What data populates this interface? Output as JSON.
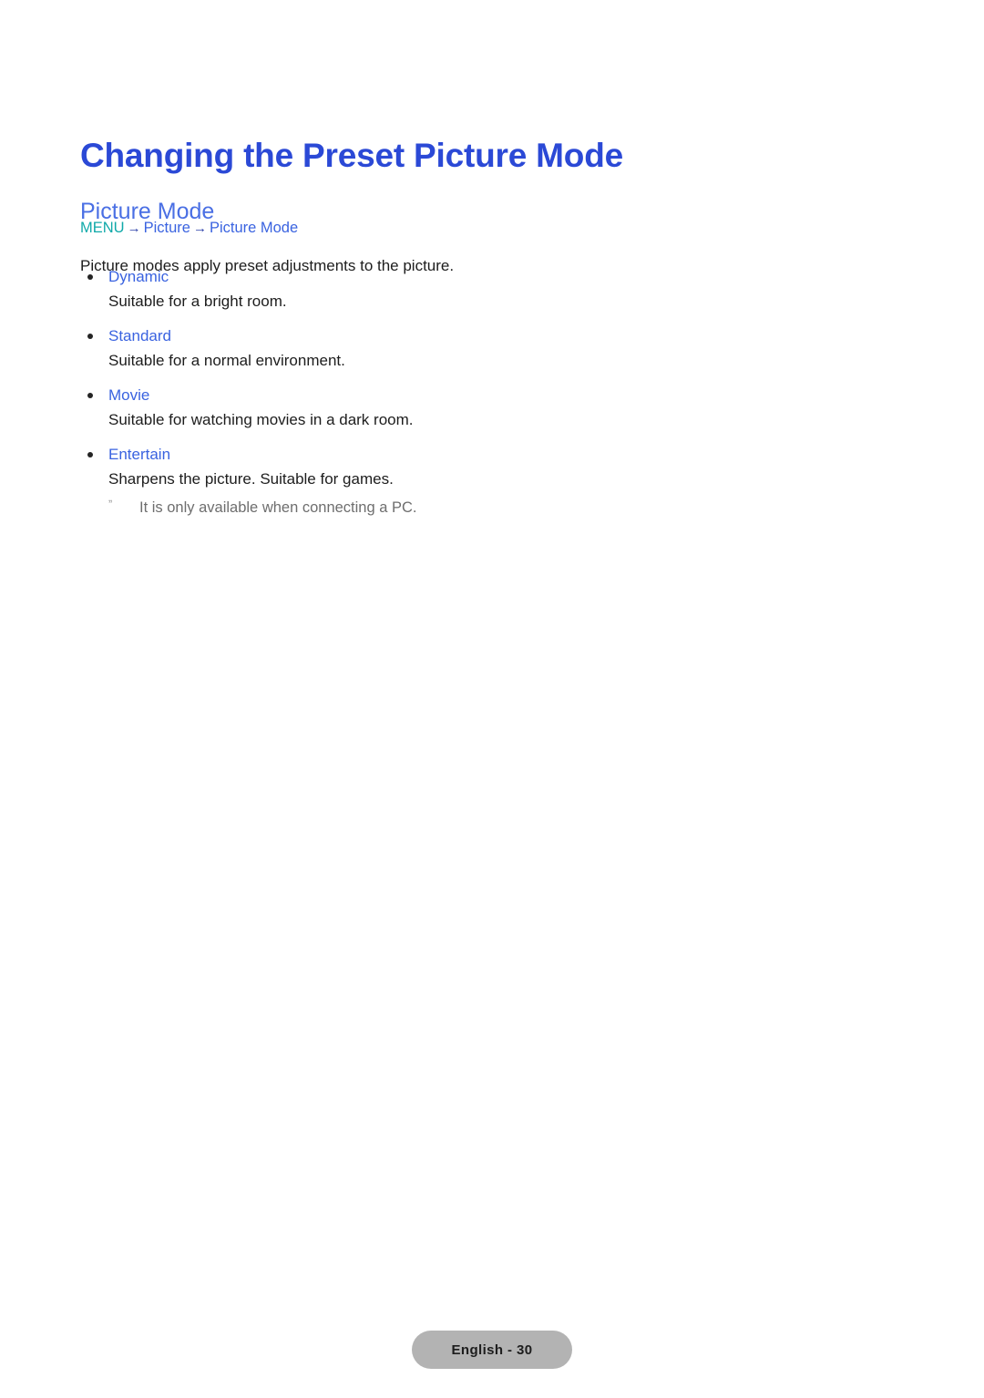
{
  "document": {
    "title": "Changing the Preset Picture Mode",
    "sub_heading": "Picture Mode",
    "intro": "Picture modes apply preset adjustments to the picture.",
    "menu_path": {
      "root": "MENU",
      "arrow": "→",
      "nodes": [
        "Picture",
        "Picture Mode"
      ]
    },
    "items": [
      {
        "label": "Dynamic",
        "description": "Suitable for a bright room."
      },
      {
        "label": "Standard",
        "description": "Suitable for a normal environment."
      },
      {
        "label": "Movie",
        "description": "Suitable for watching movies in a dark room."
      },
      {
        "label": "Entertain",
        "description": "Sharpens the picture. Suitable for games."
      }
    ],
    "note": {
      "marker": "ˮ",
      "text": "It is only available when connecting a PC."
    },
    "footer": {
      "page_label": "English - 30"
    },
    "colors": {
      "title_blue": "#2b49d6",
      "subheading_blue": "#4a6fe4",
      "label_blue": "#3a63e0",
      "menu_teal": "#10a9a9",
      "menu_arrow": "#2b3fa8",
      "body_text": "#1d1d1d",
      "note_text": "#6e6e6e",
      "footer_pill": "#b3b3b3",
      "background": "#ffffff"
    }
  }
}
